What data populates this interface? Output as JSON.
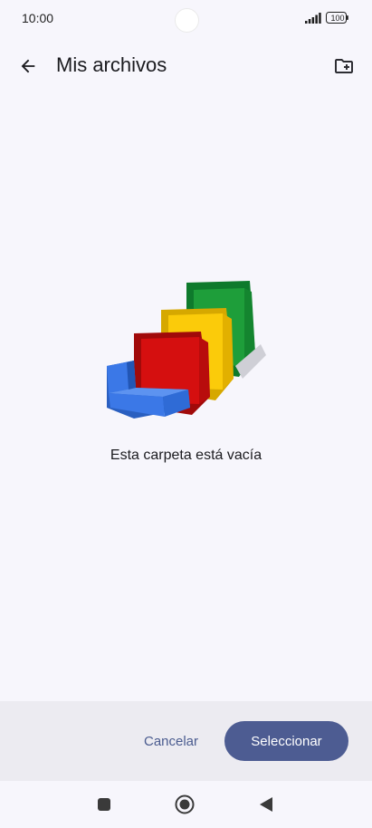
{
  "status_bar": {
    "time": "10:00",
    "battery": "100",
    "icons": [
      "signal-icon",
      "battery-icon"
    ]
  },
  "app_bar": {
    "title": "Mis archivos",
    "back_icon": "arrow-left-icon",
    "new_folder_icon": "create-new-folder-icon"
  },
  "empty_state": {
    "message": "Esta carpeta está vacía",
    "illustration": "empty-folders-illustration",
    "colors": [
      "#3b78e7",
      "#d50f0f",
      "#fbcb0a",
      "#1e9e3a"
    ]
  },
  "actions": {
    "cancel_label": "Cancelar",
    "select_label": "Seleccionar"
  },
  "nav_bar": {
    "icons": [
      "recent-apps-icon",
      "home-icon",
      "back-icon"
    ]
  },
  "colors": {
    "background": "#f7f6fc",
    "panel": "#ecebf1",
    "primary": "#4d5c92",
    "text_accent": "#4a5b8f"
  }
}
